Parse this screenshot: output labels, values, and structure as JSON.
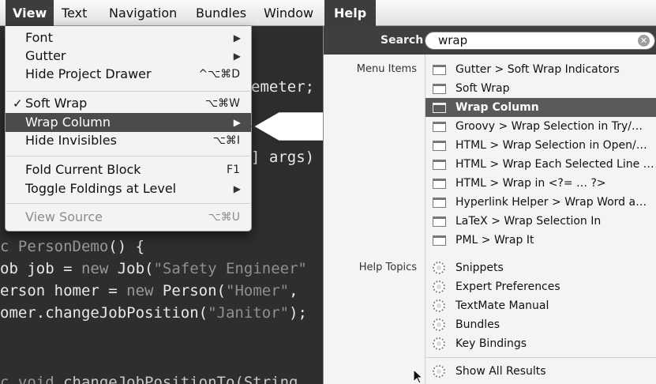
{
  "menubar": {
    "items": [
      {
        "label": "View",
        "active": true
      },
      {
        "label": "Text",
        "active": false
      },
      {
        "label": "Navigation",
        "active": false
      },
      {
        "label": "Bundles",
        "active": false
      },
      {
        "label": "Window",
        "active": false
      },
      {
        "label": "Help",
        "active": true
      }
    ]
  },
  "view_menu": {
    "items": [
      {
        "label": "Font",
        "submenu": true
      },
      {
        "label": "Gutter",
        "submenu": true
      },
      {
        "label": "Hide Project Drawer",
        "shortcut": "^⌥⌘D"
      },
      {
        "label": "Soft Wrap",
        "shortcut": "⌥⌘W",
        "checked": true,
        "check_mark": "✓"
      },
      {
        "label": "Wrap Column",
        "submenu": true,
        "highlighted": true
      },
      {
        "label": "Hide Invisibles",
        "shortcut": "⌥⌘I"
      },
      {
        "label": "Fold Current Block",
        "shortcut": "F1"
      },
      {
        "label": "Toggle Foldings at Level",
        "submenu": true
      },
      {
        "label": "View Source",
        "shortcut": "⌥⌘U",
        "disabled": true
      }
    ]
  },
  "help_menu": {
    "search_label": "Search",
    "search_value": "wrap",
    "menu_items_label": "Menu Items",
    "help_topics_label": "Help Topics",
    "menu_items": [
      "Gutter > Soft Wrap Indicators",
      "Soft Wrap",
      "Wrap Column",
      "Groovy > Wrap Selection in Try/…",
      "HTML > Wrap Selection in Open/…",
      "HTML > Wrap Each Selected Line …",
      "HTML > Wrap in <?= … ?>",
      "Hyperlink Helper > Wrap Word a…",
      "LaTeX > Wrap Selection In",
      "PML > Wrap It"
    ],
    "highlighted_menu_item": "Wrap Column",
    "help_topics": [
      "Snippets",
      "Expert Preferences",
      "TextMate Manual",
      "Bundles",
      "Key Bindings"
    ],
    "show_all": "Show All Results"
  },
  "editor": {
    "fragments": {
      "l1": "emeter;",
      "l2": "] args)",
      "l3a": "c ",
      "l3b": "PersonDemo",
      "l3c": "() {",
      "l4a": "ob job = ",
      "l4b": "new ",
      "l4c": "Job(",
      "l4d": "\"Safety Engineer\"",
      "l5a": "erson homer = ",
      "l5b": "new ",
      "l5c": "Person(",
      "l5d": "\"Homer\"",
      "l5e": ",",
      "l6a": "omer.changeJobPosition(",
      "l6b": "\"Janitor\"",
      "l6c": ");",
      "l7a": "c void ",
      "l7b": "changeJobPositionTo(String"
    }
  }
}
